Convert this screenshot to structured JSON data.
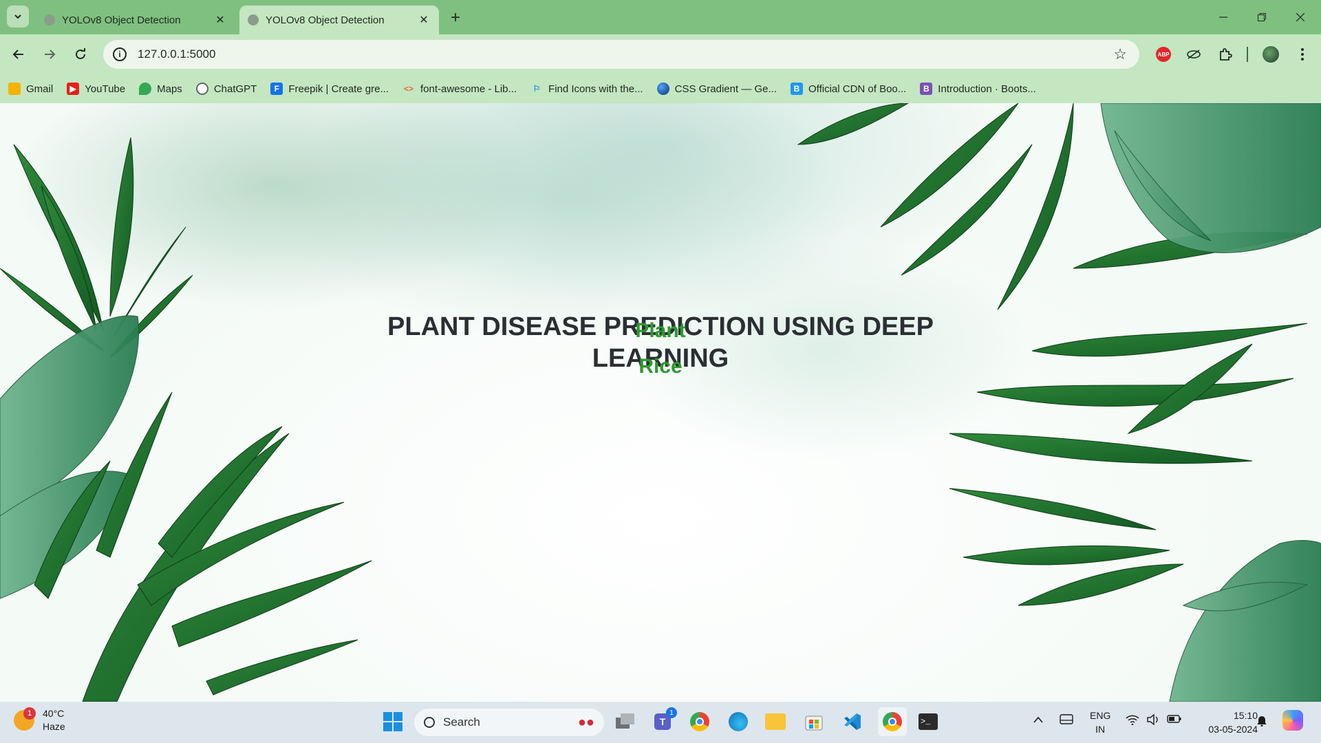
{
  "browser": {
    "tabs": [
      {
        "title": "YOLOv8 Object Detection",
        "active": false
      },
      {
        "title": "YOLOv8 Object Detection",
        "active": true
      }
    ],
    "url": "127.0.0.1:5000",
    "bookmarks": [
      {
        "label": "Gmail",
        "icon": "gmail-icon",
        "color": "#f4b400"
      },
      {
        "label": "YouTube",
        "icon": "youtube-icon",
        "color": "#e62117"
      },
      {
        "label": "Maps",
        "icon": "maps-icon",
        "color": "#34a853"
      },
      {
        "label": "ChatGPT",
        "icon": "chatgpt-icon",
        "color": "#5f6b68"
      },
      {
        "label": "Freepik | Create gre...",
        "icon": "freepik-icon",
        "color": "#1273eb"
      },
      {
        "label": "font-awesome - Lib...",
        "icon": "code-icon",
        "color": "#e36b2c"
      },
      {
        "label": "Find Icons with the...",
        "icon": "flag-icon",
        "color": "#228be6"
      },
      {
        "label": "CSS Gradient — Ge...",
        "icon": "gradient-icon",
        "color": "#1a4fa0"
      },
      {
        "label": "Official CDN of Boo...",
        "icon": "bootstrap-cdn-icon",
        "color": "#2196f3"
      },
      {
        "label": "Introduction · Boots...",
        "icon": "bootstrap-icon",
        "color": "#7952b3"
      }
    ],
    "extensions": {
      "abp_label": "ABP"
    }
  },
  "page": {
    "heading": "PLANT DISEASE PREDICTION USING DEEP LEARNING",
    "links": [
      {
        "label": "Plant"
      },
      {
        "label": "Rice"
      }
    ],
    "link_color": "#2e9a2e"
  },
  "taskbar": {
    "weather": {
      "temp": "40°C",
      "condition": "Haze",
      "badge": "1"
    },
    "search_label": "Search",
    "teams_badge": "1",
    "lang_top": "ENG",
    "lang_bottom": "IN",
    "time": "15:10",
    "date": "03-05-2024"
  }
}
